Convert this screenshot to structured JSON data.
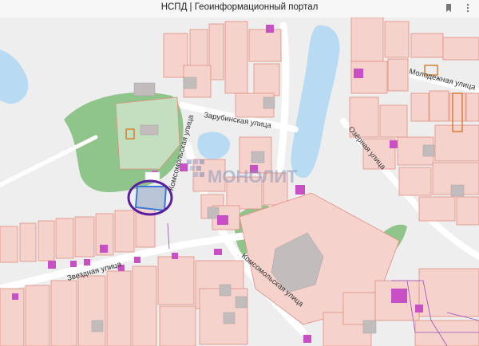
{
  "window": {
    "title": "НСПД | Геоинформационный портал",
    "icons": [
      "bookmark-icon",
      "menu-dots-icon"
    ]
  },
  "map": {
    "watermark": "МОНОЛИТ",
    "streets": {
      "zarubinskaya": "Зарубинская улица",
      "komsomolskaya_upper": "Комсомольская улица",
      "komsomolskaya_lower": "Комсомольская улица",
      "zvezdnaya": "Звездная улица",
      "ozernaya": "Озёрная улица",
      "molodezhnaya": "Молодежная улица"
    },
    "colors": {
      "parcel_fill": "#f6d2cc",
      "parcel_stroke": "#e28f83",
      "building": "#c94fc5",
      "water": "#b9daf3",
      "green": "#8fc48a",
      "highlight_ring": "#5a1fa0",
      "selected_parcel": "#3b7bd6"
    }
  }
}
